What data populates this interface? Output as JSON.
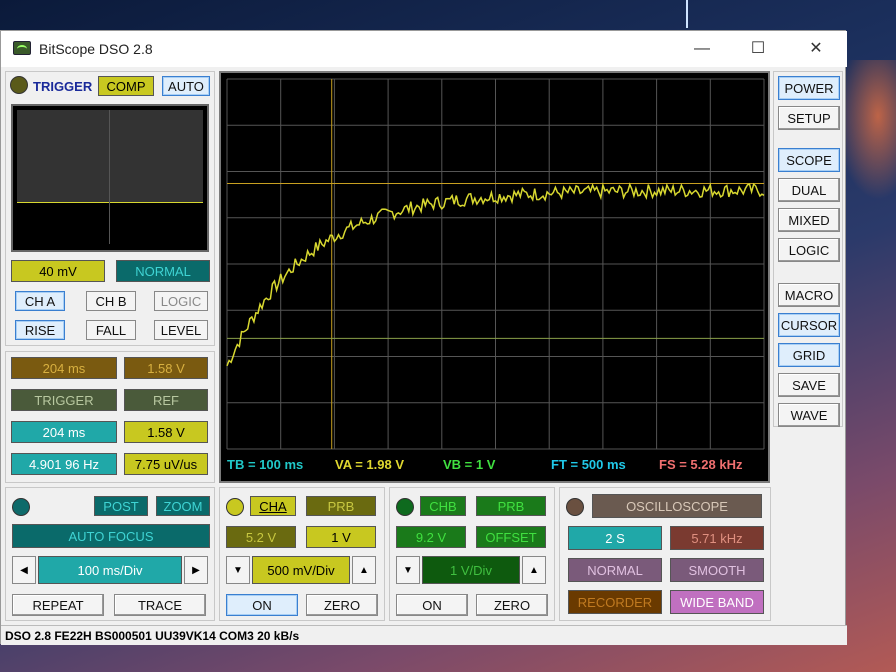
{
  "window": {
    "title": "BitScope DSO 2.8",
    "minimize": "—",
    "maximize": "☐",
    "close": "✕"
  },
  "trigger": {
    "label": "TRIGGER",
    "comp": "COMP",
    "auto": "AUTO",
    "level_value": "40 mV",
    "mode": "NORMAL",
    "cha": "CH A",
    "chb": "CH B",
    "logic": "LOGIC",
    "rise": "RISE",
    "fall": "FALL",
    "level": "LEVEL"
  },
  "cursor": {
    "time": "204 ms",
    "volts": "1.58 V",
    "trigger_label": "TRIGGER",
    "ref_label": "REF",
    "time2": "204 ms",
    "volts2": "1.58 V",
    "freq": "4.901 96 Hz",
    "slew": "7.75 uV/us"
  },
  "timebase": {
    "post": "POST",
    "zoom": "ZOOM",
    "autofocus": "AUTO FOCUS",
    "value": "100 ms/Div",
    "repeat": "REPEAT",
    "trace": "TRACE"
  },
  "cha": {
    "label": "CHA",
    "prb": "PRB",
    "offset": "5.2 V",
    "prb_value": "1 V",
    "value": "500 mV/Div",
    "on": "ON",
    "zero": "ZERO"
  },
  "chb": {
    "label": "CHB",
    "prb": "PRB",
    "offset": "9.2 V",
    "offset_label": "OFFSET",
    "value": "1 V/Div",
    "on": "ON",
    "zero": "ZERO"
  },
  "osc": {
    "label": "OSCILLOSCOPE",
    "s": "2 S",
    "rate": "5.71 kHz",
    "normal": "NORMAL",
    "smooth": "SMOOTH",
    "recorder": "RECORDER",
    "wideband": "WIDE BAND"
  },
  "side": {
    "power": "POWER",
    "setup": "SETUP",
    "scope": "SCOPE",
    "dual": "DUAL",
    "mixed": "MIXED",
    "logic": "LOGIC",
    "macro": "MACRO",
    "cursor": "CURSOR",
    "grid": "GRID",
    "save": "SAVE",
    "wave": "WAVE"
  },
  "readouts": {
    "tb": "TB = 100 ms",
    "va": "VA = 1.98 V",
    "vb": "VB = 1 V",
    "ft": "FT = 500 ms",
    "fs": "FS = 5.28 kHz"
  },
  "status": "DSO 2.8 FE22H BS000501 UU39VK14 COM3 20 kB/s",
  "colors": {
    "trace": "#d8d830",
    "grid": "#555555",
    "cha": "#c8c820",
    "chb": "#1a7a1a",
    "cyan": "#20b0b0"
  },
  "chart_data": {
    "type": "line",
    "description_free": true,
    "trace_shape": "rc-charge",
    "time_constant_div": 1.5,
    "start_div_above_bottom": 1.8,
    "final_div_above_bottom": 5.6,
    "tail_noise_div": 0.15
  }
}
